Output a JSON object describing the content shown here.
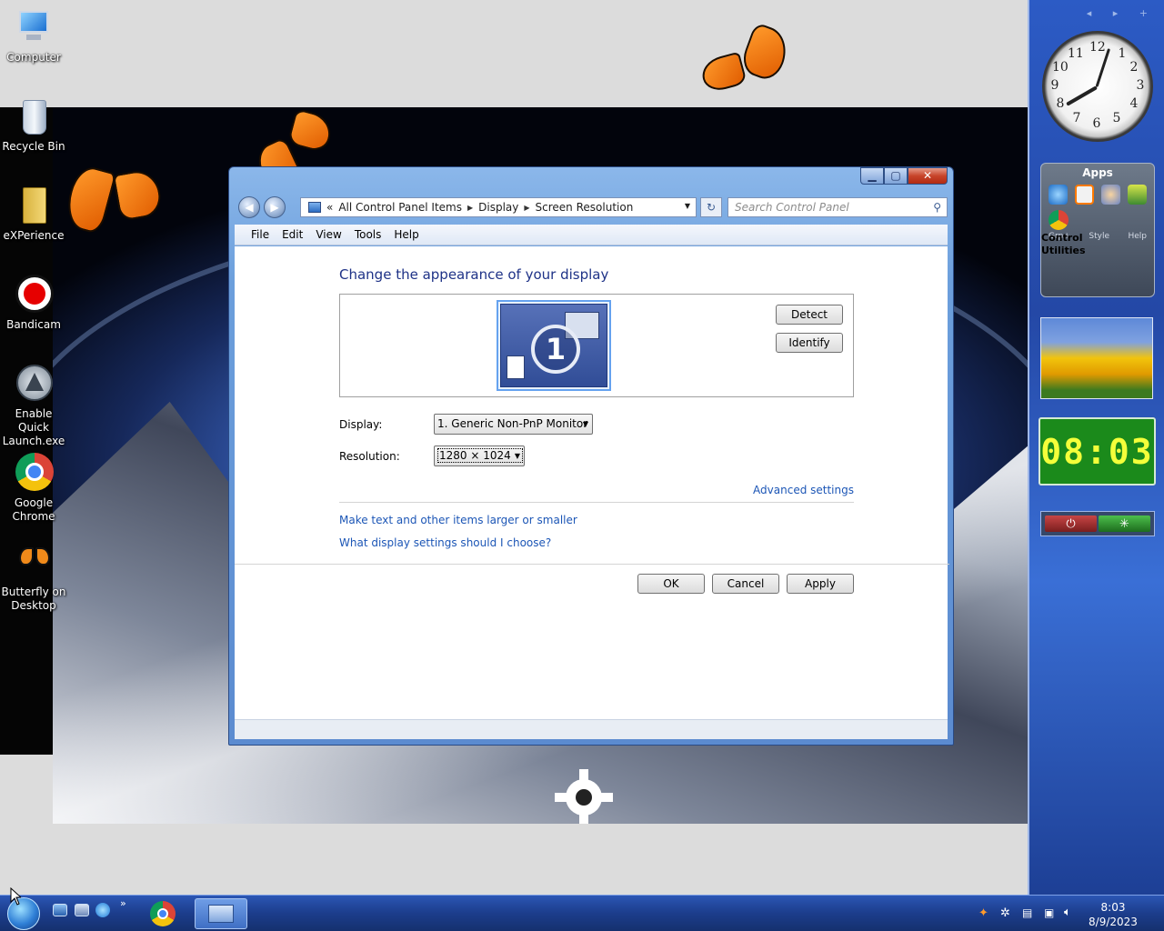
{
  "desktop_icons": [
    {
      "label": "Computer"
    },
    {
      "label": "Recycle Bin"
    },
    {
      "label": "eXPerience"
    },
    {
      "label": "Bandicam"
    },
    {
      "label": "Enable Quick Launch.exe"
    },
    {
      "label": "Google Chrome"
    },
    {
      "label": "Butterfly on Desktop"
    }
  ],
  "sidebar": {
    "clock": {
      "numbers": [
        "12",
        "1",
        "2",
        "3",
        "4",
        "5",
        "6",
        "7",
        "8",
        "9",
        "10",
        "11"
      ]
    },
    "apps": {
      "title": "Apps",
      "utilities": "Utilities",
      "control": "Control",
      "footer": [
        "Grp+",
        "Style",
        "Help"
      ]
    },
    "digital_clock": "08:03",
    "power_icons": [
      "power-icon",
      "loading-icon"
    ]
  },
  "window": {
    "address": {
      "back_chevrons": "«",
      "crumbs": [
        "All Control Panel Items",
        "Display",
        "Screen Resolution"
      ]
    },
    "search_placeholder": "Search Control Panel",
    "menu": [
      "File",
      "Edit",
      "View",
      "Tools",
      "Help"
    ],
    "heading": "Change the appearance of your display",
    "monitor_number": "1",
    "detect_label": "Detect",
    "identify_label": "Identify",
    "display_label": "Display:",
    "display_value": "1. Generic Non-PnP Monitor",
    "resolution_label": "Resolution:",
    "resolution_value": "1280 × 1024",
    "advanced_link": "Advanced settings",
    "link_text_size": "Make text and other items larger or smaller",
    "link_help": "What display settings should I choose?",
    "ok_label": "OK",
    "cancel_label": "Cancel",
    "apply_label": "Apply"
  },
  "taskbar": {
    "quicklaunch_more": "»",
    "time": "8:03",
    "date": "8/9/2023"
  },
  "colors": {
    "link": "#1c56b6",
    "heading": "#1e3287",
    "digital": "#1b8a1b"
  }
}
